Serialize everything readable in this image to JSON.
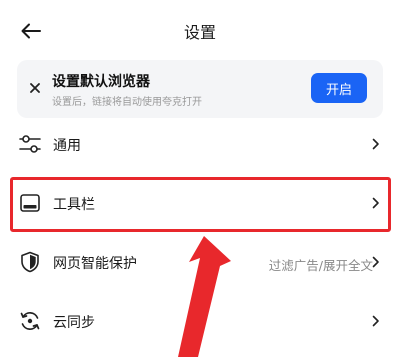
{
  "header": {
    "title": "设置"
  },
  "banner": {
    "title": "设置默认浏览器",
    "subtitle": "设置后，链接将自动使用夸克打开",
    "button": "开启"
  },
  "rows": [
    {
      "label": "通用",
      "value": ""
    },
    {
      "label": "工具栏",
      "value": ""
    },
    {
      "label": "网页智能保护",
      "value": "过滤广告/展开全文"
    },
    {
      "label": "云同步",
      "value": ""
    }
  ],
  "icons": {
    "back": "back-arrow-icon",
    "close": "close-icon",
    "general": "sliders-icon",
    "toolbar": "toolbar-icon",
    "protect": "shield-icon",
    "sync": "sync-icon",
    "chevron": "chevron-right-icon"
  },
  "colors": {
    "accent": "#1a64f5",
    "highlight": "#e8282c",
    "banner_bg": "#f4f5f7"
  }
}
